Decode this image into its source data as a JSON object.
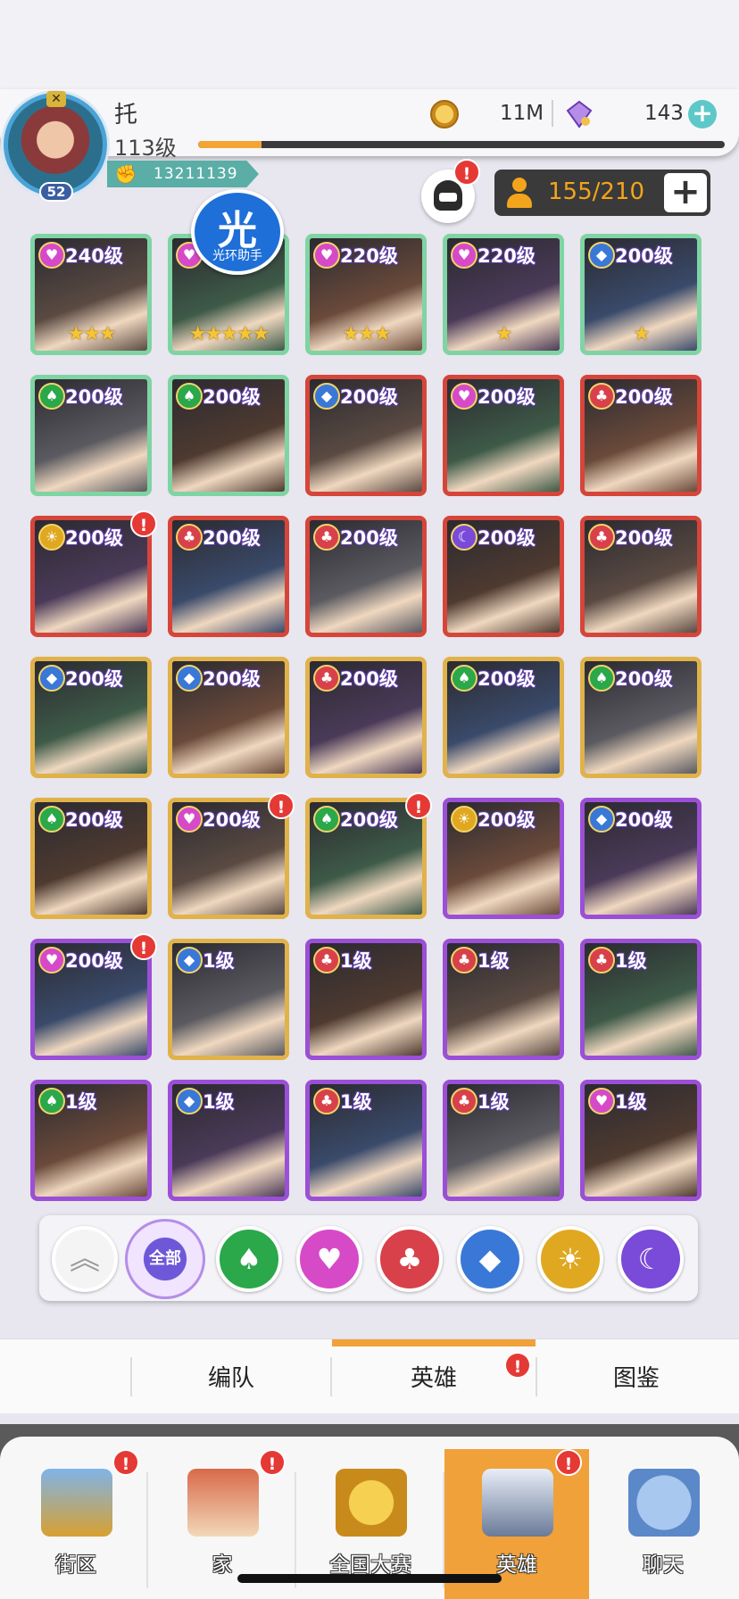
{
  "player": {
    "name": "托",
    "level": "113级",
    "exp_fraction": 0.12,
    "avatar_level": "52",
    "power": "13211139"
  },
  "resources": {
    "gold": "11M",
    "gems": "143"
  },
  "roster": {
    "count": "155/210"
  },
  "helper_badge": {
    "big": "光",
    "small": "光环助手"
  },
  "heroes": [
    {
      "level": "240级",
      "faction": "heart",
      "rarity": "rainbow",
      "stars": "★★★",
      "alert": false
    },
    {
      "level": "",
      "faction": "heart",
      "rarity": "rainbow",
      "stars": "★★★★★",
      "alert": false
    },
    {
      "level": "220级",
      "faction": "heart",
      "rarity": "rainbow",
      "stars": "★★★",
      "alert": false
    },
    {
      "level": "220级",
      "faction": "heart",
      "rarity": "rainbow",
      "stars": "★",
      "alert": false
    },
    {
      "level": "200级",
      "faction": "diamond",
      "rarity": "rainbow",
      "stars": "★",
      "alert": false
    },
    {
      "level": "200级",
      "faction": "spade",
      "rarity": "rainbow",
      "stars": "",
      "alert": false
    },
    {
      "level": "200级",
      "faction": "spade",
      "rarity": "rainbow",
      "stars": "",
      "alert": false
    },
    {
      "level": "200级",
      "faction": "diamond",
      "rarity": "red",
      "stars": "",
      "alert": false
    },
    {
      "level": "200级",
      "faction": "heart",
      "rarity": "red",
      "stars": "",
      "alert": false
    },
    {
      "level": "200级",
      "faction": "club",
      "rarity": "red",
      "stars": "",
      "alert": false
    },
    {
      "level": "200级",
      "faction": "sun",
      "rarity": "red",
      "stars": "",
      "alert": true
    },
    {
      "level": "200级",
      "faction": "club",
      "rarity": "red",
      "stars": "",
      "alert": false
    },
    {
      "level": "200级",
      "faction": "club",
      "rarity": "red",
      "stars": "",
      "alert": false
    },
    {
      "level": "200级",
      "faction": "moon",
      "rarity": "red",
      "stars": "",
      "alert": false
    },
    {
      "level": "200级",
      "faction": "club",
      "rarity": "red",
      "stars": "",
      "alert": false
    },
    {
      "level": "200级",
      "faction": "diamond",
      "rarity": "gold",
      "stars": "",
      "alert": false
    },
    {
      "level": "200级",
      "faction": "diamond",
      "rarity": "gold",
      "stars": "",
      "alert": false
    },
    {
      "level": "200级",
      "faction": "club",
      "rarity": "gold",
      "stars": "",
      "alert": false
    },
    {
      "level": "200级",
      "faction": "spade",
      "rarity": "gold",
      "stars": "",
      "alert": false
    },
    {
      "level": "200级",
      "faction": "spade",
      "rarity": "gold",
      "stars": "",
      "alert": false
    },
    {
      "level": "200级",
      "faction": "spade",
      "rarity": "gold",
      "stars": "",
      "alert": false
    },
    {
      "level": "200级",
      "faction": "heart",
      "rarity": "gold",
      "stars": "",
      "alert": true
    },
    {
      "level": "200级",
      "faction": "spade",
      "rarity": "gold",
      "stars": "",
      "alert": true
    },
    {
      "level": "200级",
      "faction": "sun",
      "rarity": "purple",
      "stars": "",
      "alert": false
    },
    {
      "level": "200级",
      "faction": "diamond",
      "rarity": "purple",
      "stars": "",
      "alert": false
    },
    {
      "level": "200级",
      "faction": "heart",
      "rarity": "purple",
      "stars": "",
      "alert": true
    },
    {
      "level": "1级",
      "faction": "diamond",
      "rarity": "gold",
      "stars": "",
      "alert": false
    },
    {
      "level": "1级",
      "faction": "club",
      "rarity": "purple",
      "stars": "",
      "alert": false
    },
    {
      "level": "1级",
      "faction": "club",
      "rarity": "purple",
      "stars": "",
      "alert": false
    },
    {
      "level": "1级",
      "faction": "club",
      "rarity": "purple",
      "stars": "",
      "alert": false
    },
    {
      "level": "1级",
      "faction": "spade",
      "rarity": "purple",
      "stars": "",
      "alert": false
    },
    {
      "level": "1级",
      "faction": "diamond",
      "rarity": "purple",
      "stars": "",
      "alert": false
    },
    {
      "level": "1级",
      "faction": "club",
      "rarity": "purple",
      "stars": "",
      "alert": false
    },
    {
      "level": "1级",
      "faction": "club",
      "rarity": "purple",
      "stars": "",
      "alert": false
    },
    {
      "level": "1级",
      "faction": "heart",
      "rarity": "purple",
      "stars": "",
      "alert": false
    }
  ],
  "faction_icons": {
    "heart": "heart-icon",
    "diamond": "diamond-icon",
    "spade": "spade-icon",
    "club": "club-icon",
    "sun": "sun-icon",
    "moon": "moon-icon"
  },
  "faction_colors": {
    "heart": "#d64ac8",
    "diamond": "#3a78d8",
    "spade": "#2aa84a",
    "club": "#d8414a",
    "sun": "#e0a820",
    "moon": "#7a4ad8"
  },
  "rarity_colors": {
    "rainbow": "#7fd4a4",
    "red": "#d6453a",
    "gold": "#e0b24a",
    "purple": "#9b4fd6"
  },
  "filters": {
    "all_label": "全部",
    "items": [
      "spade",
      "heart",
      "club",
      "diamond",
      "sun",
      "moon"
    ]
  },
  "sub_tabs": {
    "formation": "编队",
    "heroes": "英雄",
    "codex": "图鉴"
  },
  "bottom_nav": {
    "district": "街区",
    "home": "家",
    "national": "全国大赛",
    "heroes": "英雄",
    "chat": "聊天"
  }
}
